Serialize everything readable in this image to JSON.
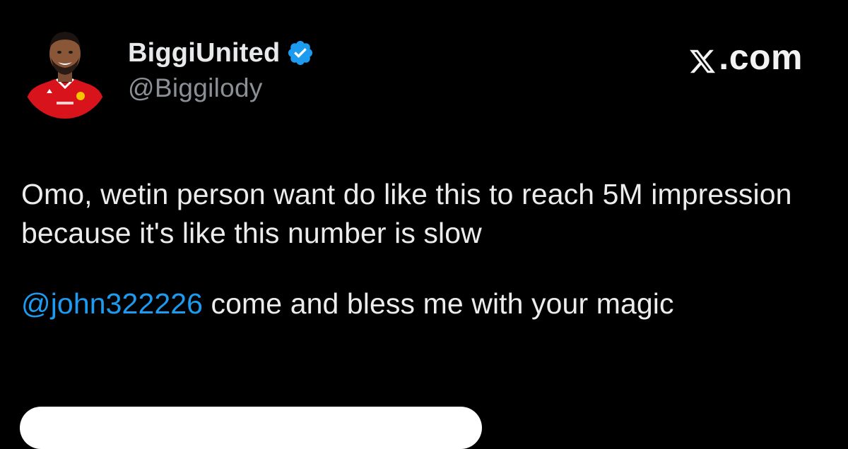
{
  "user": {
    "display_name": "BiggiUnited",
    "handle": "@Biggilody",
    "verified": true,
    "avatar_description": "avatar"
  },
  "source": {
    "label": ".com",
    "logo": "x-logo-icon"
  },
  "tweet": {
    "line1": "Omo, wetin person want do like this to reach 5M impression because it's like this number is slow",
    "mention": "@john322226",
    "line2_rest": " come and bless me with your magic"
  },
  "colors": {
    "background": "#000000",
    "text": "#e7e9ea",
    "handle": "#8b9096",
    "mention": "#1d9bf0",
    "verified": "#1d9bf0",
    "jersey": "#d9131b"
  }
}
